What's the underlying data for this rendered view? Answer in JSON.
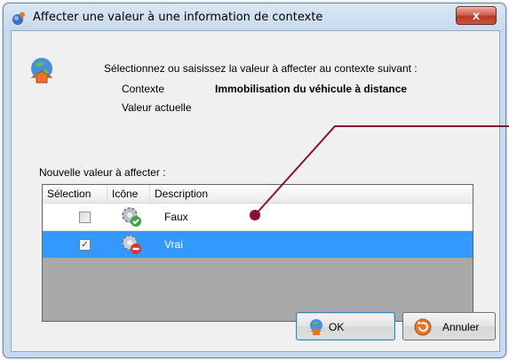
{
  "window": {
    "title": "Affecter une valeur à une information de contexte",
    "close_label": "x"
  },
  "header": {
    "prompt": "Sélectionnez ou saisissez la valeur à affecter au contexte suivant :",
    "context_label": "Contexte",
    "context_value": "Immobilisation du véhicule à distance",
    "current_value_label": "Valeur actuelle"
  },
  "grid": {
    "caption": "Nouvelle valeur à affecter :",
    "columns": [
      "Sélection",
      "Icône",
      "Description"
    ],
    "rows": [
      {
        "checked": false,
        "icon": "gear-check-icon",
        "description": "Faux",
        "selected": false
      },
      {
        "checked": true,
        "icon": "gear-stop-icon",
        "description": "Vrai",
        "selected": true
      }
    ]
  },
  "buttons": {
    "ok_label": "OK",
    "cancel_label": "Annuler"
  },
  "colors": {
    "selection": "#3399ff",
    "annotation": "#8b0f2e"
  }
}
